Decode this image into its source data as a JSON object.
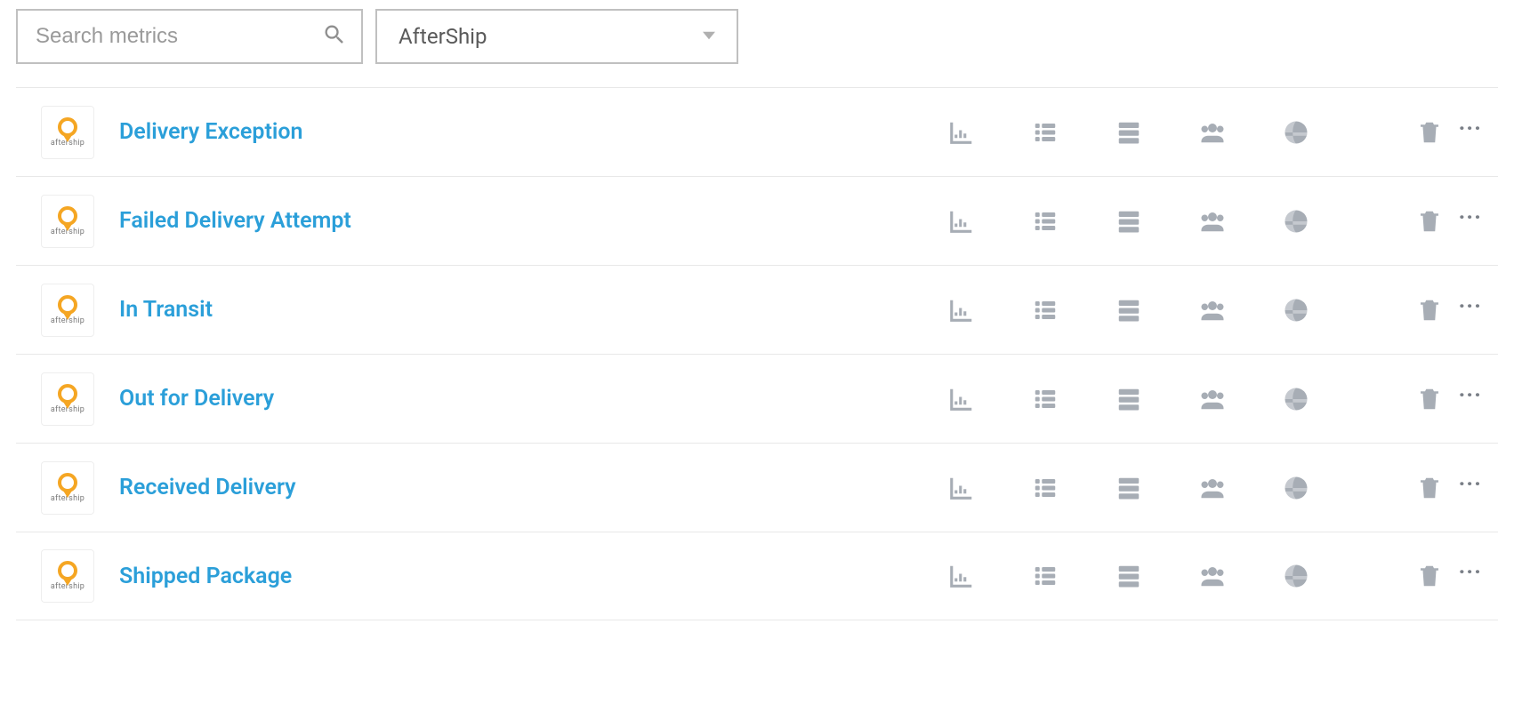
{
  "search": {
    "placeholder": "Search metrics"
  },
  "dropdown": {
    "selected": "AfterShip"
  },
  "brand": {
    "label": "aftership"
  },
  "metrics": [
    {
      "name": "Delivery Exception"
    },
    {
      "name": "Failed Delivery Attempt"
    },
    {
      "name": "In Transit"
    },
    {
      "name": "Out for Delivery"
    },
    {
      "name": "Received Delivery"
    },
    {
      "name": "Shipped Package"
    }
  ]
}
